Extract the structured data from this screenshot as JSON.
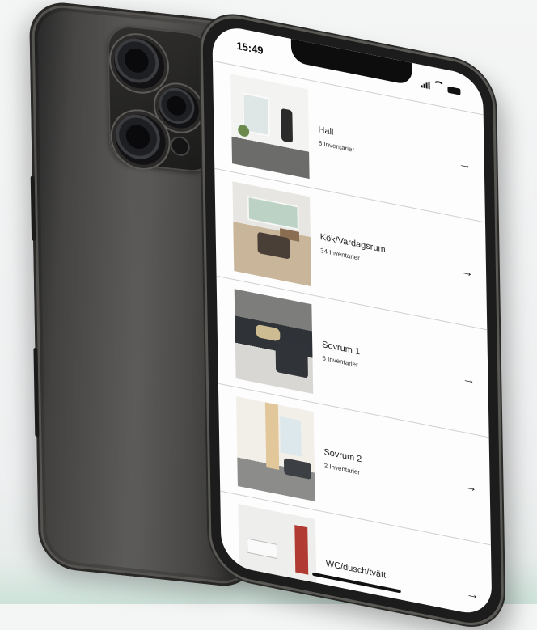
{
  "status_bar": {
    "time": "15:49"
  },
  "rooms": [
    {
      "name": "Hall",
      "count": "8 Inventarier"
    },
    {
      "name": "Kök/Vardagsrum",
      "count": "34 Inventarier"
    },
    {
      "name": "Sovrum 1",
      "count": "6 Inventarier"
    },
    {
      "name": "Sovrum 2",
      "count": "2 Inventarier"
    },
    {
      "name": "WC/dusch/tvätt",
      "count": ""
    }
  ],
  "icons": {
    "arrow": "→"
  }
}
